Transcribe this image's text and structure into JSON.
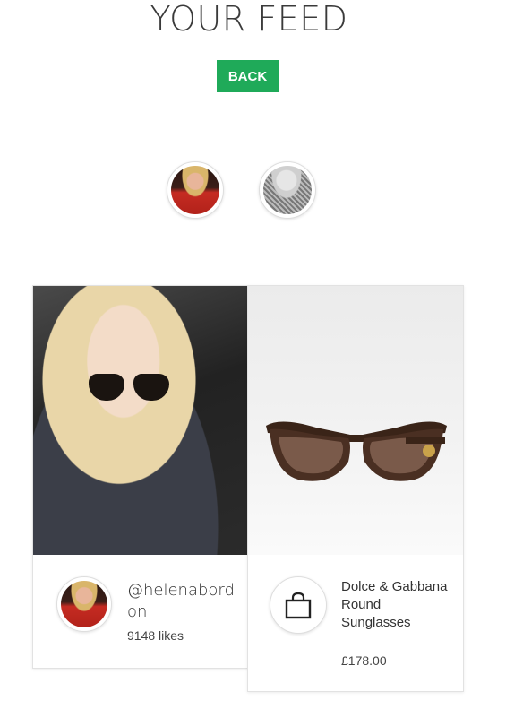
{
  "header": {
    "title": "YOUR FEED",
    "back_label": "BACK"
  },
  "colors": {
    "accent": "#1faa59"
  },
  "stories": [
    {
      "name": "story-avatar-1",
      "icon": "avatar"
    },
    {
      "name": "story-avatar-2",
      "icon": "avatar"
    }
  ],
  "post": {
    "handle": "@helenabordon",
    "likes": "9148 likes"
  },
  "product": {
    "name": "Dolce & Gabbana Round Sunglasses",
    "price": "£178.00",
    "icon": "shopping-bag-icon"
  }
}
